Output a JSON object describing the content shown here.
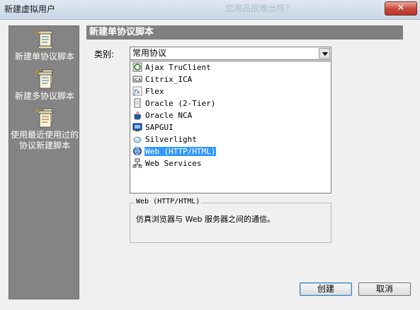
{
  "window": {
    "title": "新建虚拟用户",
    "ghost_text": "您用品很难出吗？",
    "close_glyph": "✕"
  },
  "sidebar": {
    "items": [
      {
        "label": "新建单协议脚本",
        "icon": "script-single-icon"
      },
      {
        "label": "新建多协议脚本",
        "icon": "script-multi-icon"
      },
      {
        "label": "使用最近使用过的协议新建脚本",
        "icon": "script-recent-icon"
      }
    ]
  },
  "header": {
    "title": "新建单协议脚本"
  },
  "category": {
    "label": "类别:",
    "selected": "常用协议"
  },
  "protocols": [
    {
      "label": "Ajax TruClient",
      "icon": "ajax-truclient-icon"
    },
    {
      "label": "Citrix_ICA",
      "icon": "citrix-ica-icon"
    },
    {
      "label": "Flex",
      "icon": "flex-icon"
    },
    {
      "label": "Oracle (2-Tier)",
      "icon": "oracle-2tier-icon"
    },
    {
      "label": "Oracle NCA",
      "icon": "oracle-nca-icon"
    },
    {
      "label": "SAPGUI",
      "icon": "sapgui-icon"
    },
    {
      "label": "Silverlight",
      "icon": "silverlight-icon"
    },
    {
      "label": "Web (HTTP/HTML)",
      "icon": "web-http-icon",
      "selected": true
    },
    {
      "label": "Web Services",
      "icon": "web-services-icon"
    }
  ],
  "description": {
    "title": "Web (HTTP/HTML)",
    "text": "仿真浏览器与 Web 服务器之间的通信。"
  },
  "buttons": {
    "create": "创建",
    "cancel": "取消"
  },
  "colors": {
    "sidebar_bg": "#848484",
    "header_bg": "#808080",
    "selection": "#3399ff",
    "close_red": "#c9453a"
  }
}
